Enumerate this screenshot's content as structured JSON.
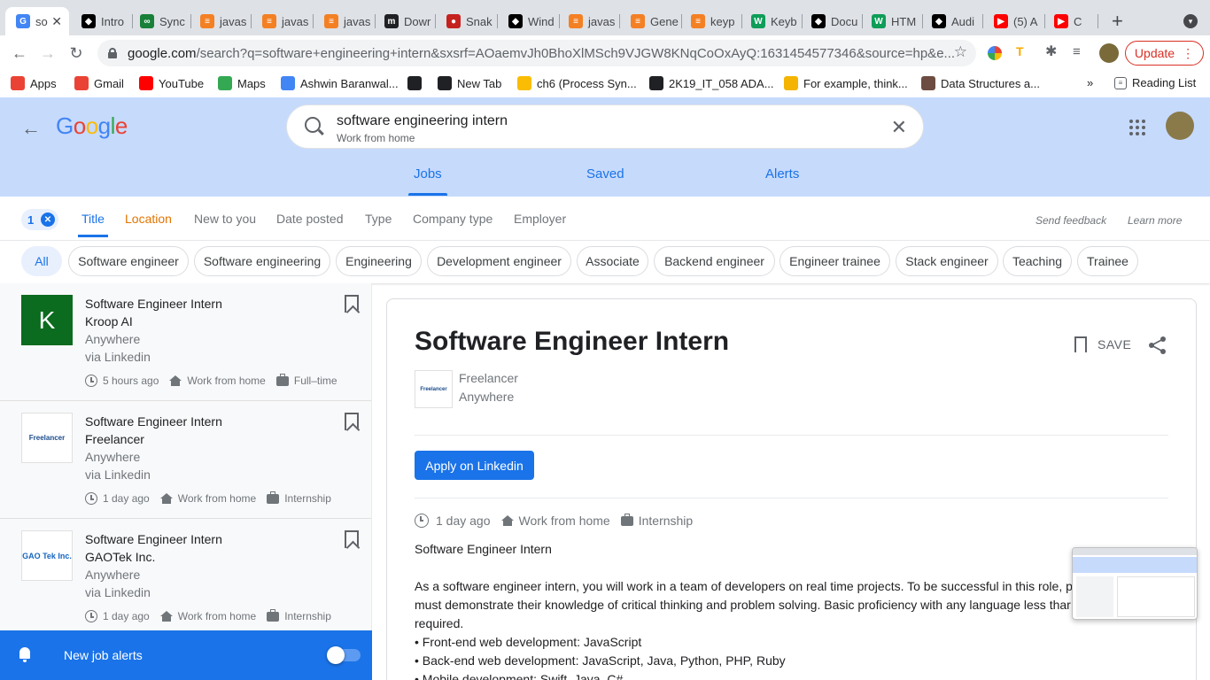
{
  "browser": {
    "tabs": [
      {
        "label": "so",
        "fav_color": "#4285f4",
        "fav": "G"
      },
      {
        "label": "Intro",
        "fav_color": "#000000",
        "fav": "◆"
      },
      {
        "label": "Sync",
        "fav_color": "#188038",
        "fav": "∞"
      },
      {
        "label": "javas",
        "fav_color": "#f48024",
        "fav": "≡"
      },
      {
        "label": "javas",
        "fav_color": "#f48024",
        "fav": "≡"
      },
      {
        "label": "javas",
        "fav_color": "#f48024",
        "fav": "≡"
      },
      {
        "label": "Dowr",
        "fav_color": "#202124",
        "fav": "m"
      },
      {
        "label": "Snak",
        "fav_color": "#c5221f",
        "fav": "●"
      },
      {
        "label": "Wind",
        "fav_color": "#000000",
        "fav": "◆"
      },
      {
        "label": "javas",
        "fav_color": "#f48024",
        "fav": "≡"
      },
      {
        "label": "Gene",
        "fav_color": "#f48024",
        "fav": "≡"
      },
      {
        "label": "keyp",
        "fav_color": "#f48024",
        "fav": "≡"
      },
      {
        "label": "Keyb",
        "fav_color": "#0f9d58",
        "fav": "W"
      },
      {
        "label": "Docu",
        "fav_color": "#000000",
        "fav": "◆"
      },
      {
        "label": "HTM",
        "fav_color": "#0f9d58",
        "fav": "W"
      },
      {
        "label": "Audi",
        "fav_color": "#000000",
        "fav": "◆"
      },
      {
        "label": "(5) A",
        "fav_color": "#ff0000",
        "fav": "▶"
      },
      {
        "label": "C",
        "fav_color": "#ff0000",
        "fav": "▶"
      }
    ],
    "new_tab": "+",
    "url_host": "google.com",
    "url_path": "/search?q=software+engineering+intern&sxsrf=AOaemvJh0BhoXlMSch9VJGW8KNqCoOxAyQ:1631454577346&source=hp&e...",
    "update_label": "Update",
    "bookmarks": [
      {
        "label": "Apps",
        "color": "#ea4335",
        "icon": "apps-icon"
      },
      {
        "label": "Gmail",
        "color": "#ea4335",
        "icon": "gmail-icon"
      },
      {
        "label": "YouTube",
        "color": "#ff0000",
        "icon": "youtube-icon"
      },
      {
        "label": "Maps",
        "color": "#34a853",
        "icon": "maps-icon"
      },
      {
        "label": "Ashwin Baranwal...",
        "color": "#4285f4",
        "icon": "google-icon"
      },
      {
        "label": "",
        "color": "#202124",
        "icon": "github-icon"
      },
      {
        "label": "New Tab",
        "color": "#202124",
        "icon": "globe-icon"
      },
      {
        "label": "ch6 (Process Syn...",
        "color": "#fbbc04",
        "icon": "drive-icon"
      },
      {
        "label": "2K19_IT_058 ADA...",
        "color": "#202124",
        "icon": "globe-icon"
      },
      {
        "label": "For example, think...",
        "color": "#f4b400",
        "icon": "chart-icon"
      },
      {
        "label": "Data Structures a...",
        "color": "#6d4c41",
        "icon": "cc-icon"
      }
    ],
    "bookmarks_more": "»",
    "reading_list": "Reading List"
  },
  "google": {
    "logo": "Google",
    "query": "software engineering intern",
    "query_sub": "Work from home",
    "tabs": [
      "Jobs",
      "Saved",
      "Alerts"
    ],
    "filter_count": "1",
    "filters": [
      "Title",
      "Location",
      "New to you",
      "Date posted",
      "Type",
      "Company type",
      "Employer"
    ],
    "send_feedback": "Send feedback",
    "learn_more": "Learn more",
    "chips": [
      "All",
      "Software engineer",
      "Software engineering",
      "Engineering",
      "Development engineer",
      "Associate",
      "Backend engineer",
      "Engineer trainee",
      "Stack engineer",
      "Teaching",
      "Trainee"
    ]
  },
  "jobs": [
    {
      "title": "Software Engineer Intern",
      "company": "Kroop AI",
      "location": "Anywhere",
      "via": "via Linkedin",
      "posted": "5 hours ago",
      "remote": "Work from home",
      "type": "Full–time",
      "logo_letter": "K"
    },
    {
      "title": "Software Engineer Intern",
      "company": "Freelancer",
      "location": "Anywhere",
      "via": "via Linkedin",
      "posted": "1 day ago",
      "remote": "Work from home",
      "type": "Internship",
      "logo_letter": "Freelancer"
    },
    {
      "title": "Software Engineer Intern",
      "company": "GAOTek Inc.",
      "location": "Anywhere",
      "via": "via Linkedin",
      "posted": "1 day ago",
      "remote": "Work from home",
      "type": "Internship",
      "logo_letter": "GAO Tek Inc."
    }
  ],
  "alerts": {
    "label": "New job alerts"
  },
  "detail": {
    "title": "Software Engineer Intern",
    "save": "SAVE",
    "company": "Freelancer",
    "location": "Anywhere",
    "apply": "Apply on Linkedin",
    "posted": "1 day ago",
    "remote": "Work from home",
    "type": "Internship",
    "heading": "Software Engineer Intern",
    "para": "As a software engineer intern, you will work in a team of developers on real time projects. To be successful in this role, p must demonstrate their knowledge of critical thinking and problem solving. Basic proficiency with any language less thar required.",
    "bullets": [
      "• Front-end web development: JavaScript",
      "• Back-end web development: JavaScript, Java, Python, PHP, Ruby",
      "• Mobile development: Swift, Java, C#"
    ]
  }
}
